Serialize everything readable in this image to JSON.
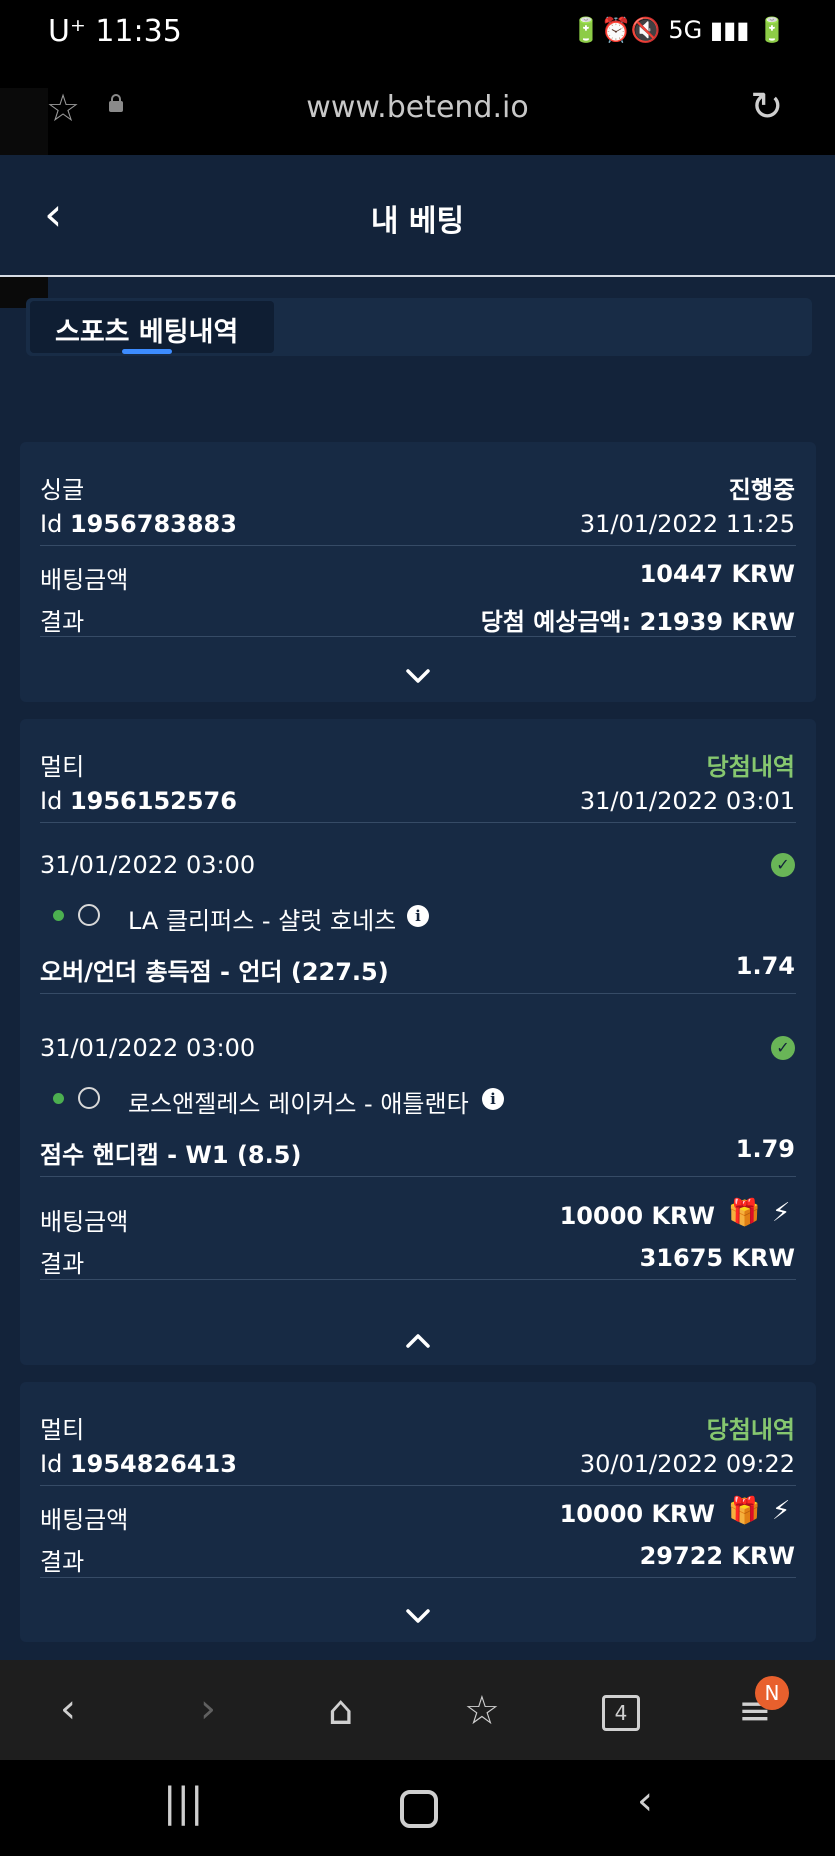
{
  "status_bar": {
    "time": "U⁺ 11:35",
    "icons": "🔋⏰🔇 5G ▮▮▮ 🔋"
  },
  "browser": {
    "url": "www.betend.io"
  },
  "header": {
    "title": "내 베팅"
  },
  "tabs": [
    {
      "label": "스포츠 베팅내역"
    }
  ],
  "bets": [
    {
      "type": "싱글",
      "status": "진행중",
      "id_label": "Id",
      "id": "1956783883",
      "datetime": "31/01/2022 11:25",
      "stake_label": "배팅금액",
      "stake": "10447 KRW",
      "result_label": "결과",
      "result": "당첨 예상금액: 21939 KRW"
    },
    {
      "type": "멀티",
      "status": "당첨내역",
      "id_label": "Id",
      "id": "1956152576",
      "datetime": "31/01/2022 03:01",
      "selections": [
        {
          "datetime": "31/01/2022 03:00",
          "match": "LA 클리퍼스 - 샬럿 호네츠",
          "market": "오버/언더 총득점 - 언더 (227.5)",
          "odds": "1.74"
        },
        {
          "datetime": "31/01/2022 03:00",
          "match": "로스앤젤레스 레이커스 - 애틀랜타",
          "market": "점수 핸디캡 - W1 (8.5)",
          "odds": "1.79"
        }
      ],
      "stake_label": "배팅금액",
      "stake": "10000 KRW",
      "result_label": "결과",
      "result": "31675 KRW"
    },
    {
      "type": "멀티",
      "status": "당첨내역",
      "id_label": "Id",
      "id": "1954826413",
      "datetime": "30/01/2022 09:22",
      "stake_label": "배팅금액",
      "stake": "10000 KRW",
      "result_label": "결과",
      "result": "29722 KRW"
    }
  ],
  "bottom_nav": {
    "tabs_count": "4",
    "profile_badge": "N"
  },
  "colors": {
    "background": "#13233a",
    "card": "#172a44",
    "win_green": "#86c76f",
    "accent": "#3d8cff"
  }
}
